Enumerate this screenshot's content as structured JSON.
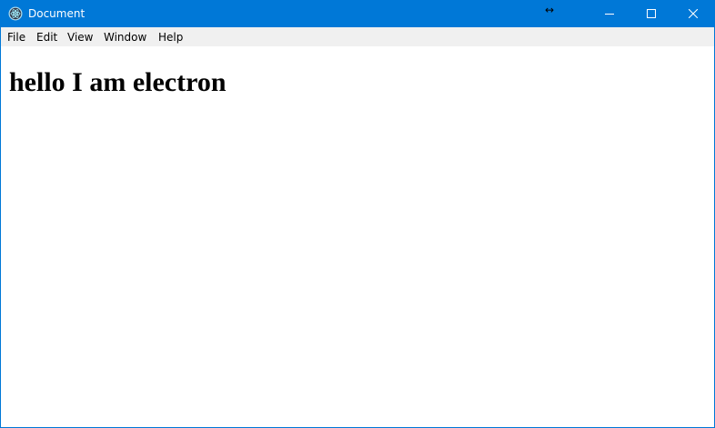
{
  "window": {
    "title": "Document",
    "accent_color": "#0078d7",
    "app_icon": "electron-icon",
    "controls": [
      "minimize-icon",
      "maximize-icon",
      "close-icon"
    ]
  },
  "cursor": {
    "glyph": "↔",
    "icon": "horizontal-resize-cursor-icon"
  },
  "menu": {
    "items": [
      "File",
      "Edit",
      "View",
      "Window",
      "Help"
    ]
  },
  "content": {
    "heading": "hello I am electron"
  }
}
